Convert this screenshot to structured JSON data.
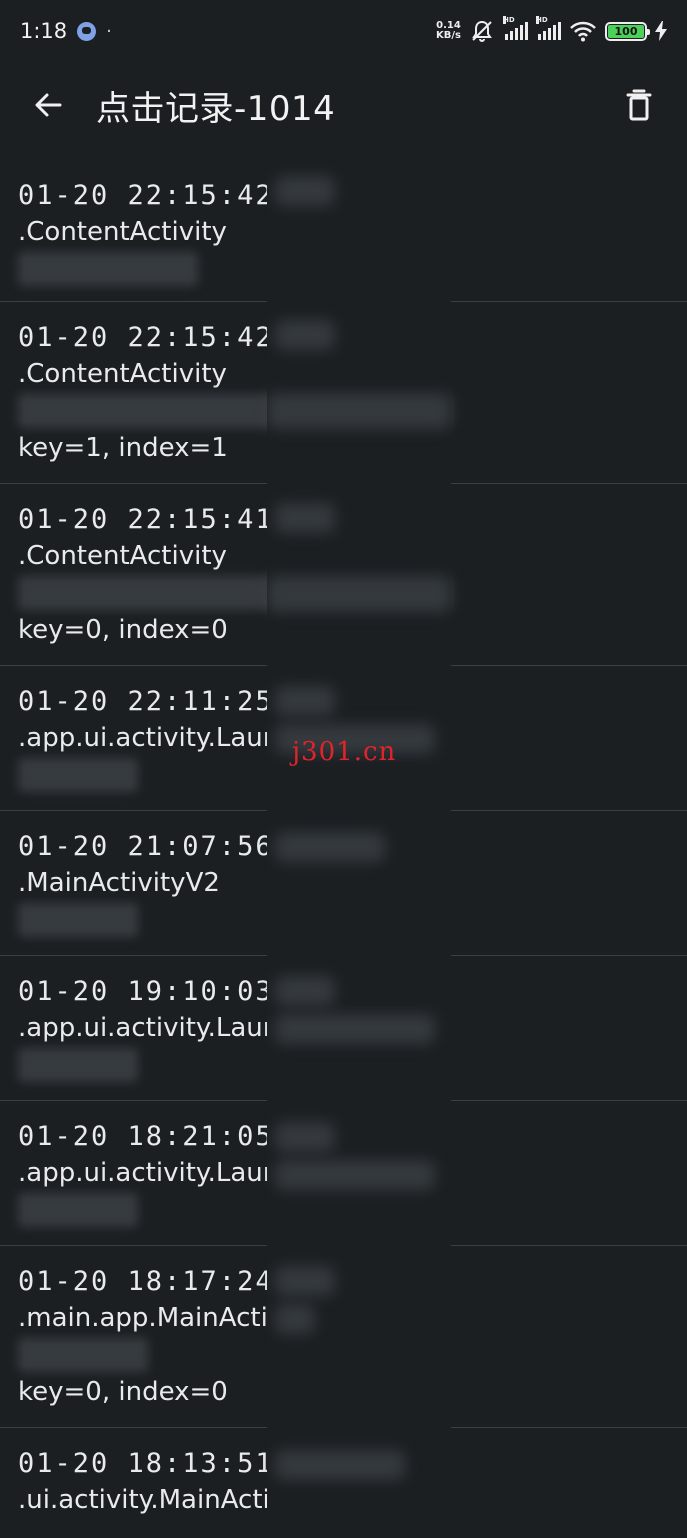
{
  "status_bar": {
    "time": "1:18",
    "dot": "·",
    "speed_value": "0.14",
    "speed_unit": "KB/s",
    "hd_label": "HD",
    "battery": "100"
  },
  "app_bar": {
    "title": "点击记录-1014",
    "back_icon": "arrow-left-icon",
    "delete_icon": "trash-icon"
  },
  "logs": [
    {
      "time": "01-20  22:15:42",
      "activity": ".ContentActivity",
      "extra": ""
    },
    {
      "time": "01-20  22:15:42",
      "activity": ".ContentActivity",
      "extra": "key=1, index=1"
    },
    {
      "time": "01-20  22:15:41",
      "activity": ".ContentActivity",
      "extra": "key=0, index=0"
    },
    {
      "time": "01-20  22:11:25",
      "activity": ".app.ui.activity.Laur",
      "extra": ""
    },
    {
      "time": "01-20  21:07:56",
      "activity": ".MainActivityV2",
      "extra": ""
    },
    {
      "time": "01-20  19:10:03",
      "activity": ".app.ui.activity.Laur",
      "extra": ""
    },
    {
      "time": "01-20  18:21:05",
      "activity": ".app.ui.activity.Laur",
      "extra": ""
    },
    {
      "time": "01-20  18:17:24",
      "activity": ".main.app.MainActi",
      "extra": "key=0, index=0"
    },
    {
      "time": "01-20  18:13:51",
      "activity": ".ui.activity.MainActivity",
      "extra": ""
    }
  ],
  "watermark": "j301.cn"
}
